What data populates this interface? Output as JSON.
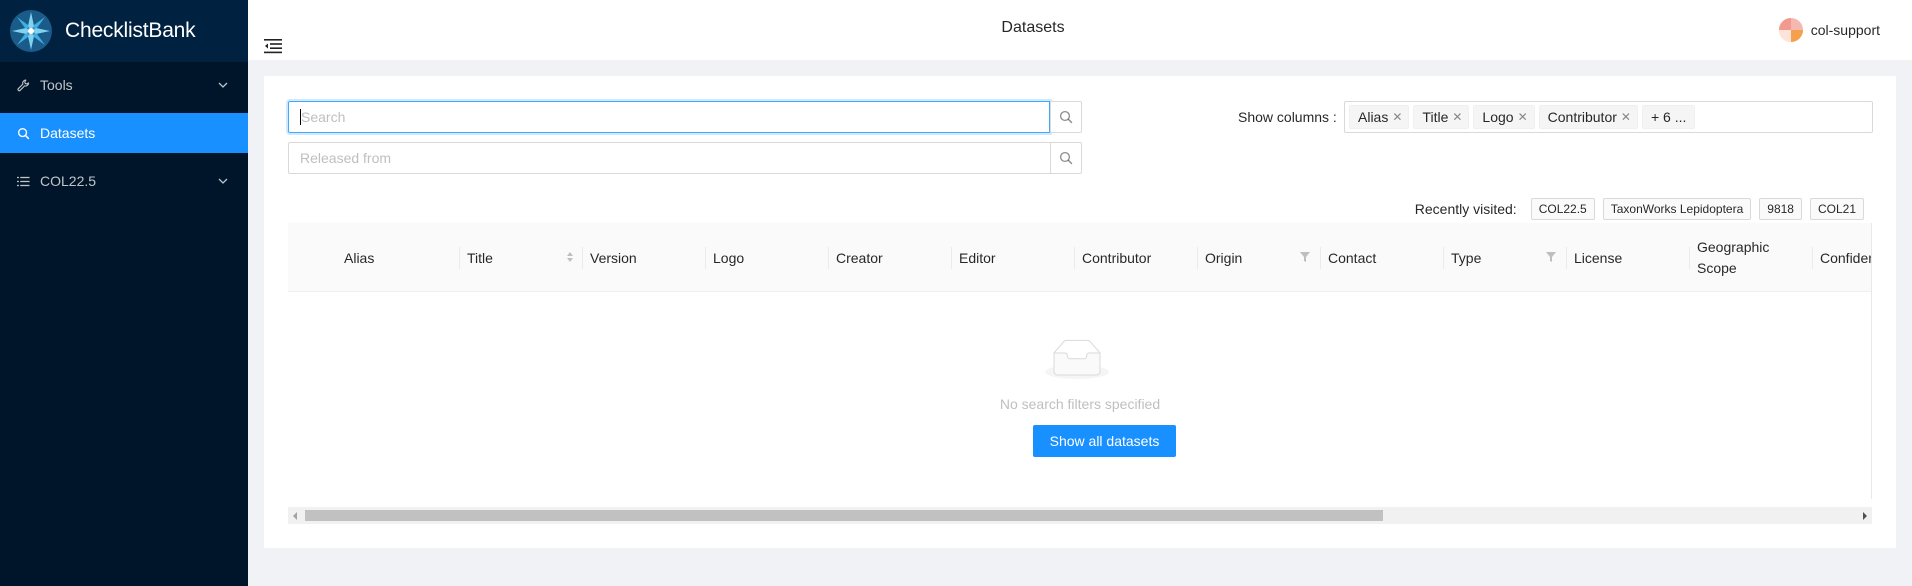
{
  "app": {
    "name": "ChecklistBank"
  },
  "sidebar": {
    "items": [
      {
        "label": "Tools",
        "icon": "tool-icon",
        "expandable": true
      },
      {
        "label": "Datasets",
        "icon": "search-icon",
        "active": true
      },
      {
        "label": "COL22.5",
        "icon": "list-icon",
        "expandable": true
      }
    ]
  },
  "header": {
    "title": "Datasets",
    "user": "col-support"
  },
  "search": {
    "placeholder": "Search",
    "released_placeholder": "Released from"
  },
  "columns": {
    "label": "Show columns",
    "selected": [
      "Alias",
      "Title",
      "Logo",
      "Contributor"
    ],
    "more": "+ 6 ..."
  },
  "recent": {
    "label": "Recently visited:",
    "items": [
      "COL22.5",
      "TaxonWorks Lepidoptera",
      "9818",
      "COL21"
    ]
  },
  "table": {
    "headers": [
      "Alias",
      "Title",
      "Version",
      "Logo",
      "Creator",
      "Editor",
      "Contributor",
      "Origin",
      "Contact",
      "Type",
      "License",
      "Geographic",
      "Scope",
      "Confiden"
    ],
    "empty_text": "No search filters specified",
    "show_all_label": "Show all datasets"
  },
  "colors": {
    "primary": "#1890ff",
    "sider": "#001529",
    "logo_bg": "#002140"
  }
}
